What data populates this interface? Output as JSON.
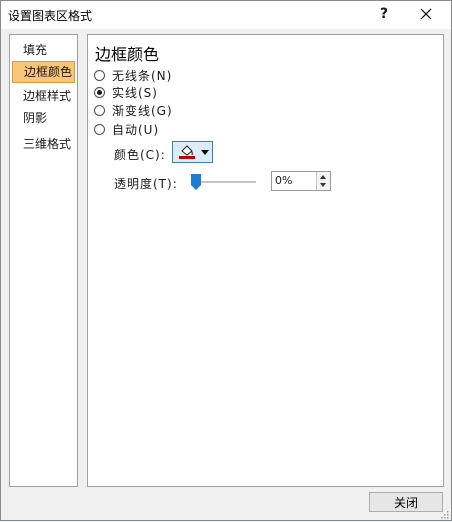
{
  "window": {
    "title": "设置图表区格式",
    "help_glyph": "?",
    "close_glyph": "✕"
  },
  "sidebar": {
    "items": [
      {
        "label": "填充",
        "selected": false
      },
      {
        "label": "边框颜色",
        "selected": true
      },
      {
        "label": "边框样式",
        "selected": false
      },
      {
        "label": "阴影",
        "selected": false
      },
      {
        "label": "三维格式",
        "selected": false
      }
    ]
  },
  "panel": {
    "title": "边框颜色",
    "options": [
      {
        "label": "无线条(N)",
        "checked": false
      },
      {
        "label": "实线(S)",
        "checked": true
      },
      {
        "label": "渐变线(G)",
        "checked": false
      },
      {
        "label": "自动(U)",
        "checked": false
      }
    ],
    "color": {
      "label": "颜色(C):",
      "icon": "paint-bucket-icon",
      "accent": "#c00000"
    },
    "transparency": {
      "label": "透明度(T):",
      "value": "0%",
      "slider_fraction": 0
    }
  },
  "footer": {
    "close_label": "关闭"
  },
  "colors": {
    "selected_bg": "#f8c678",
    "accent_blue": "#1f7bd6"
  }
}
